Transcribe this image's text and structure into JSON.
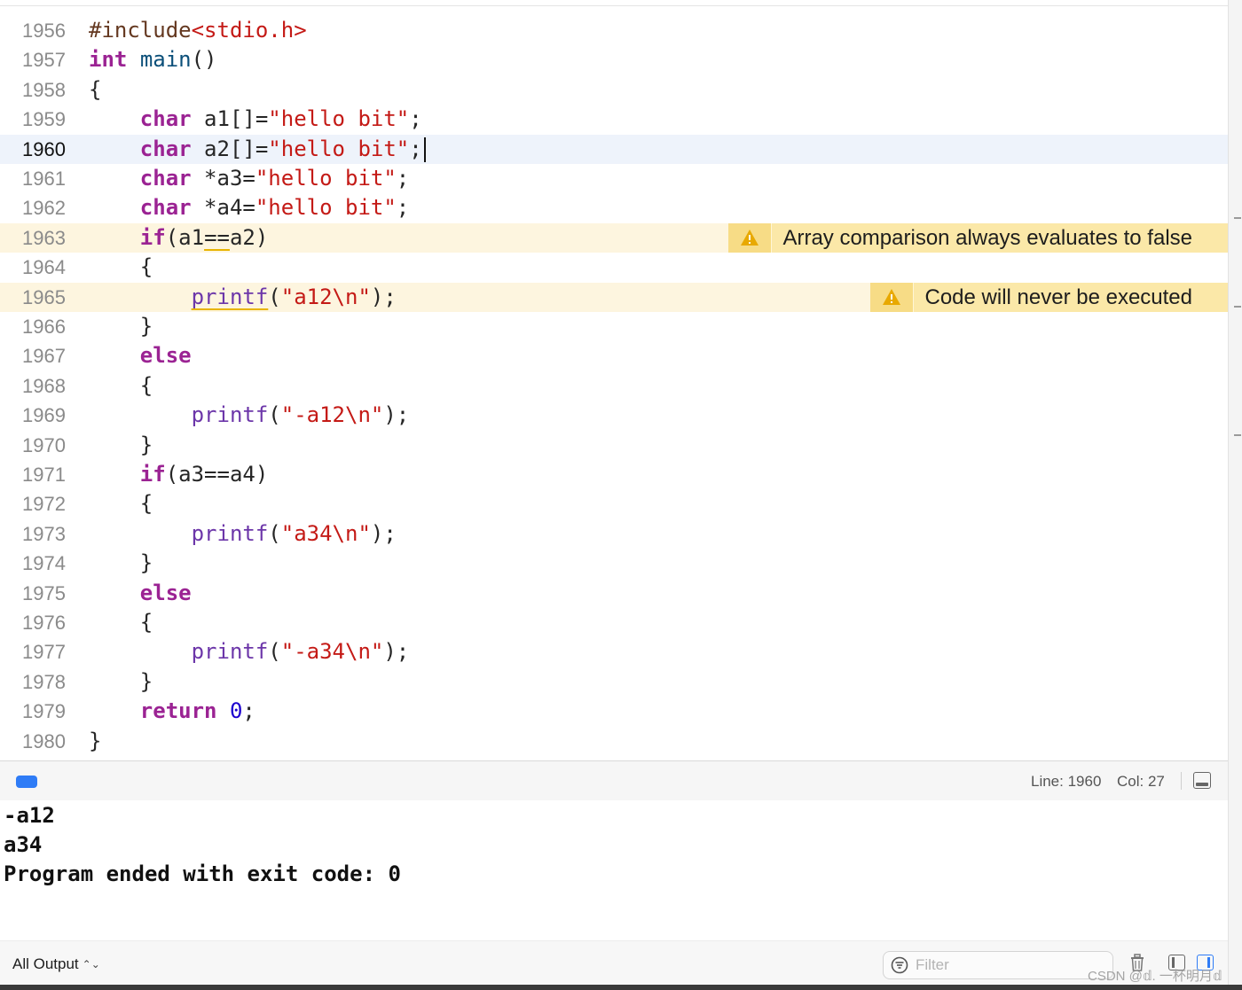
{
  "editor": {
    "lines": [
      {
        "num": "1956",
        "segs": [
          [
            "pp",
            "#include"
          ],
          [
            "str",
            "<stdio.h>"
          ]
        ]
      },
      {
        "num": "1957",
        "segs": [
          [
            "kw",
            "int"
          ],
          [
            "plain",
            " "
          ],
          [
            "decl",
            "main"
          ],
          [
            "plain",
            "()"
          ]
        ]
      },
      {
        "num": "1958",
        "segs": [
          [
            "plain",
            "{"
          ]
        ]
      },
      {
        "num": "1959",
        "segs": [
          [
            "plain",
            "    "
          ],
          [
            "kw",
            "char"
          ],
          [
            "plain",
            " a1[]="
          ],
          [
            "str",
            "\"hello bit\""
          ],
          [
            "plain",
            ";"
          ]
        ]
      },
      {
        "num": "1960",
        "current": true,
        "segs": [
          [
            "plain",
            "    "
          ],
          [
            "kw",
            "char"
          ],
          [
            "plain",
            " a2[]="
          ],
          [
            "str",
            "\"hello bit\""
          ],
          [
            "plain",
            ";"
          ]
        ]
      },
      {
        "num": "1961",
        "segs": [
          [
            "plain",
            "    "
          ],
          [
            "kw",
            "char"
          ],
          [
            "plain",
            " *a3="
          ],
          [
            "str",
            "\"hello bit\""
          ],
          [
            "plain",
            ";"
          ]
        ]
      },
      {
        "num": "1962",
        "segs": [
          [
            "plain",
            "    "
          ],
          [
            "kw",
            "char"
          ],
          [
            "plain",
            " *a4="
          ],
          [
            "str",
            "\"hello bit\""
          ],
          [
            "plain",
            ";"
          ]
        ]
      },
      {
        "num": "1963",
        "warning": "Array comparison always evaluates to false",
        "segs": [
          [
            "plain",
            "    "
          ],
          [
            "kw",
            "if"
          ],
          [
            "plain",
            "(a1"
          ],
          [
            "sq",
            "=="
          ],
          [
            "plain",
            "a2)"
          ]
        ]
      },
      {
        "num": "1964",
        "segs": [
          [
            "plain",
            "    {"
          ]
        ]
      },
      {
        "num": "1965",
        "warning": "Code will never be executed",
        "segs": [
          [
            "plain",
            "        "
          ],
          [
            "fnsq",
            "printf"
          ],
          [
            "plain",
            "("
          ],
          [
            "str",
            "\"a12\\n\""
          ],
          [
            "plain",
            ");"
          ]
        ]
      },
      {
        "num": "1966",
        "segs": [
          [
            "plain",
            "    }"
          ]
        ]
      },
      {
        "num": "1967",
        "segs": [
          [
            "plain",
            "    "
          ],
          [
            "kw",
            "else"
          ]
        ]
      },
      {
        "num": "1968",
        "segs": [
          [
            "plain",
            "    {"
          ]
        ]
      },
      {
        "num": "1969",
        "segs": [
          [
            "plain",
            "        "
          ],
          [
            "fn",
            "printf"
          ],
          [
            "plain",
            "("
          ],
          [
            "str",
            "\"-a12\\n\""
          ],
          [
            "plain",
            ");"
          ]
        ]
      },
      {
        "num": "1970",
        "segs": [
          [
            "plain",
            "    }"
          ]
        ]
      },
      {
        "num": "1971",
        "segs": [
          [
            "plain",
            "    "
          ],
          [
            "kw",
            "if"
          ],
          [
            "plain",
            "(a3==a4)"
          ]
        ]
      },
      {
        "num": "1972",
        "segs": [
          [
            "plain",
            "    {"
          ]
        ]
      },
      {
        "num": "1973",
        "segs": [
          [
            "plain",
            "        "
          ],
          [
            "fn",
            "printf"
          ],
          [
            "plain",
            "("
          ],
          [
            "str",
            "\"a34\\n\""
          ],
          [
            "plain",
            ");"
          ]
        ]
      },
      {
        "num": "1974",
        "segs": [
          [
            "plain",
            "    }"
          ]
        ]
      },
      {
        "num": "1975",
        "segs": [
          [
            "plain",
            "    "
          ],
          [
            "kw",
            "else"
          ]
        ]
      },
      {
        "num": "1976",
        "segs": [
          [
            "plain",
            "    {"
          ]
        ]
      },
      {
        "num": "1977",
        "segs": [
          [
            "plain",
            "        "
          ],
          [
            "fn",
            "printf"
          ],
          [
            "plain",
            "("
          ],
          [
            "str",
            "\"-a34\\n\""
          ],
          [
            "plain",
            ");"
          ]
        ]
      },
      {
        "num": "1978",
        "segs": [
          [
            "plain",
            "    }"
          ]
        ]
      },
      {
        "num": "1979",
        "segs": [
          [
            "plain",
            "    "
          ],
          [
            "kw",
            "return"
          ],
          [
            "plain",
            " "
          ],
          [
            "num",
            "0"
          ],
          [
            "plain",
            ";"
          ]
        ]
      },
      {
        "num": "1980",
        "segs": [
          [
            "plain",
            "}"
          ]
        ]
      }
    ]
  },
  "debug_bar": {
    "line_label": "Line: 1960",
    "col_label": "Col: 27"
  },
  "console": {
    "output": [
      "-a12",
      "a34",
      "Program ended with exit code: 0"
    ]
  },
  "bottom_bar": {
    "scope_label": "All Output",
    "filter_placeholder": "Filter"
  },
  "watermark": "CSDN @𝕕. 一杯明月𝕕",
  "colors": {
    "keyword": "#9b2393",
    "string": "#c41a16",
    "function": "#6c36a9",
    "warning_bg": "#fbe8a8",
    "current_line_bg": "#eef3fb",
    "accent": "#2f7cf6"
  }
}
